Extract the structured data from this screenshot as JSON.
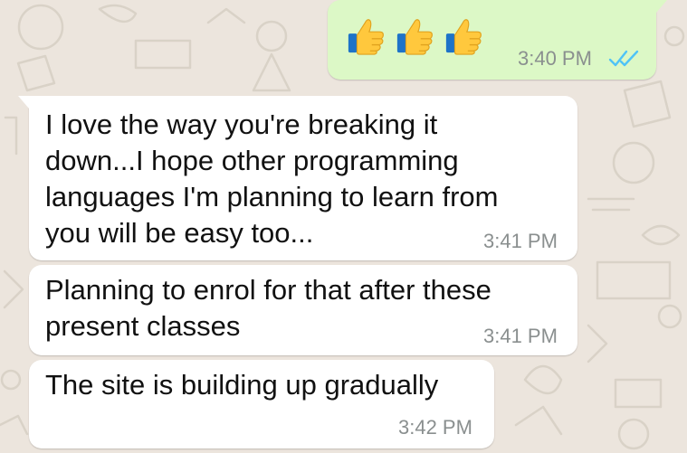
{
  "theme": {
    "wallpaper": "#ECE5DD",
    "outgoing_bubble": "#DCF8C6",
    "incoming_bubble": "#FFFFFF",
    "read_tick_color": "#4FC3F7",
    "timestamp_color": "#8a8f8f"
  },
  "messages": [
    {
      "direction": "outgoing",
      "content": "three thumbs-up emoji",
      "emoji": [
        "thumbs-up",
        "thumbs-up",
        "thumbs-up"
      ],
      "time": "3:40 PM",
      "status": "read"
    },
    {
      "direction": "incoming",
      "text": "I love the way you're breaking it\ndown...I hope other programming\nlanguages I'm planning to learn from\nyou will be easy too...",
      "time": "3:41 PM"
    },
    {
      "direction": "incoming",
      "text": "Planning to enrol for that after these\npresent classes",
      "time": "3:41 PM"
    },
    {
      "direction": "incoming",
      "text": "The site is building up gradually",
      "time": "3:42 PM"
    }
  ]
}
